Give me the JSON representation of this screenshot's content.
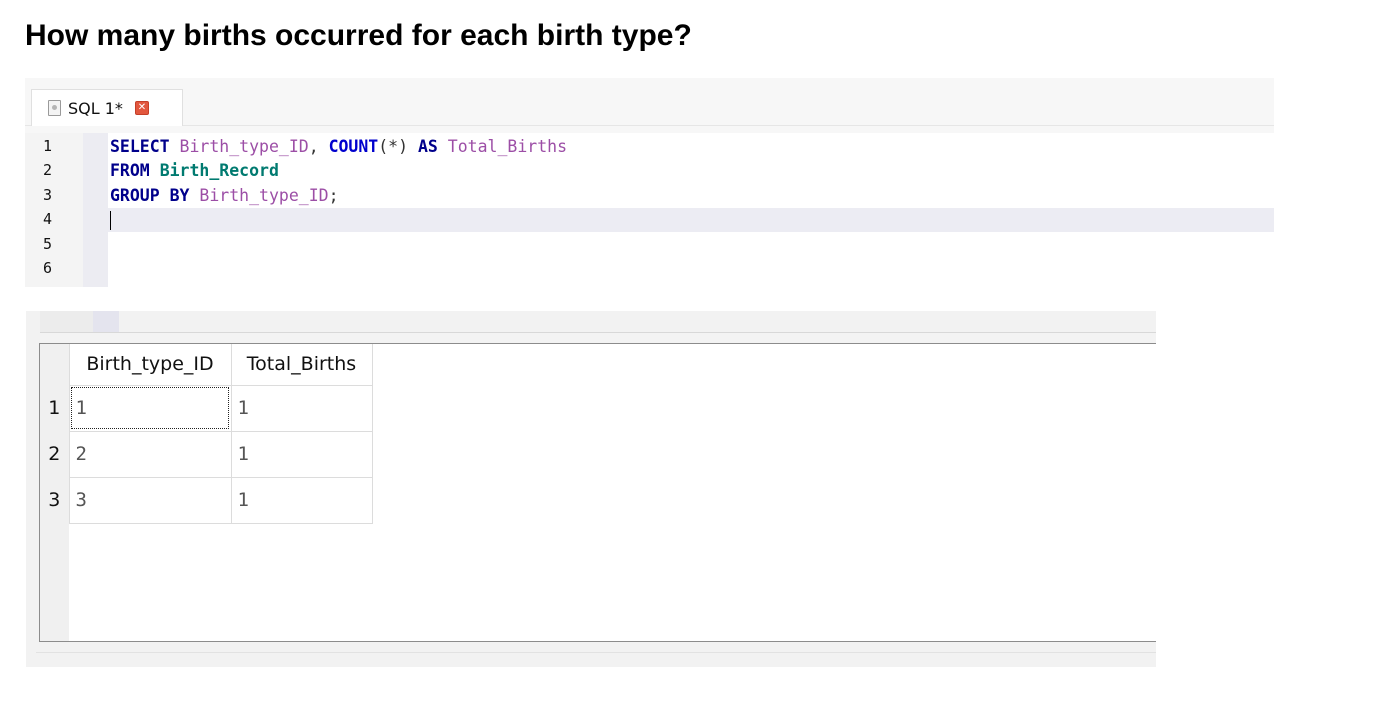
{
  "question": "How many births occurred for each birth type?",
  "editor": {
    "tab": {
      "label": "SQL 1*",
      "icon": "sql-file-icon",
      "close_icon": "close-icon",
      "close_color": "#e2573e"
    },
    "line_numbers": [
      "1",
      "2",
      "3",
      "4",
      "5",
      "6"
    ],
    "code": {
      "line1": {
        "kw_select": "SELECT",
        "col1": "Birth_type_ID",
        "comma": ",",
        "kw_count": "COUNT",
        "paren": "(*)",
        "kw_as": "AS",
        "alias": "Total_Births"
      },
      "line2": {
        "kw_from": "FROM",
        "table": "Birth_Record"
      },
      "line3": {
        "kw_group_by": "GROUP BY",
        "col": "Birth_type_ID",
        "semicolon": ";"
      }
    },
    "colors": {
      "keyword": "#00008b",
      "identifier": "#9c4ea6",
      "table": "#007a70"
    }
  },
  "results": {
    "columns": [
      "Birth_type_ID",
      "Total_Births"
    ],
    "rows": [
      {
        "num": "1",
        "cells": [
          "1",
          "1"
        ]
      },
      {
        "num": "2",
        "cells": [
          "2",
          "1"
        ]
      },
      {
        "num": "3",
        "cells": [
          "3",
          "1"
        ]
      }
    ]
  }
}
